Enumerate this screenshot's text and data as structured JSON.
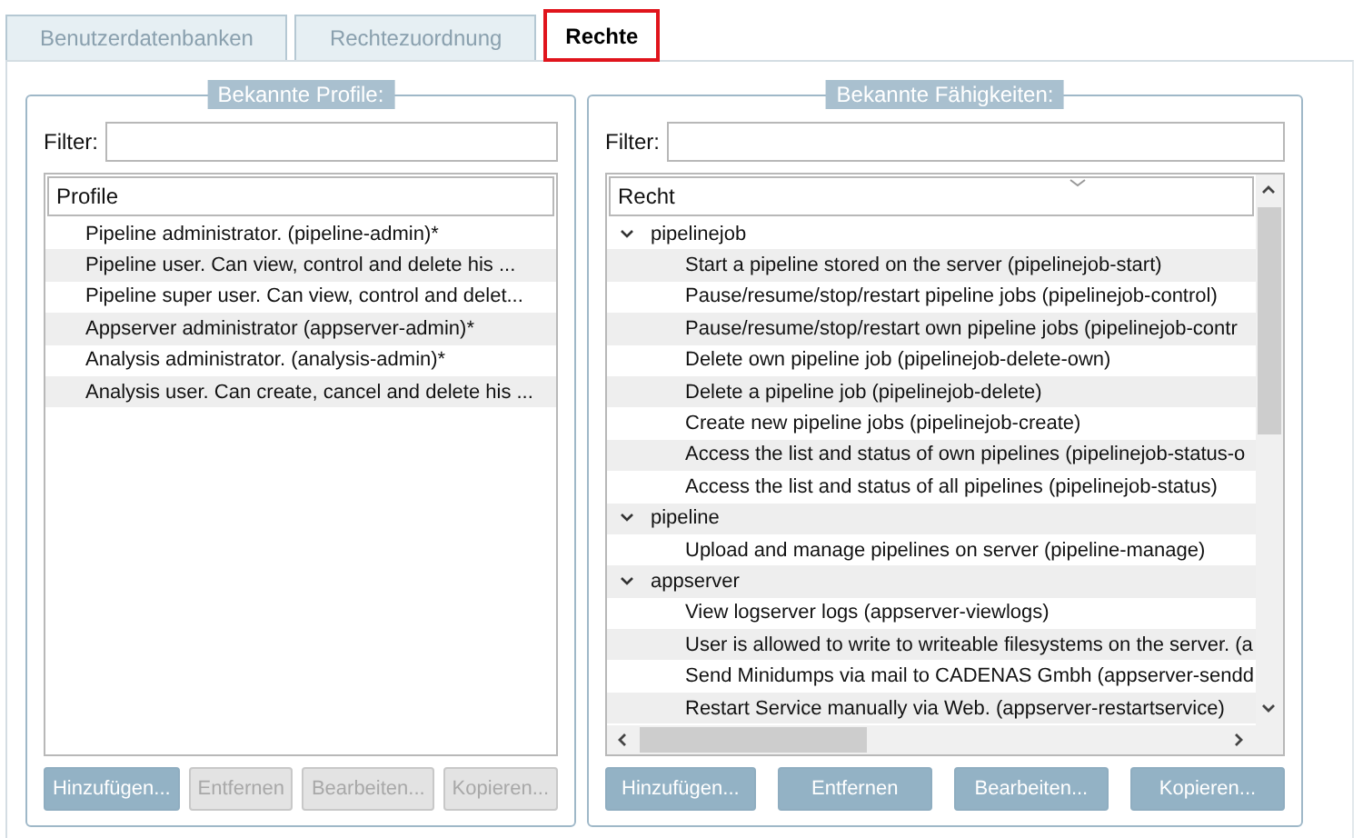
{
  "tabs": [
    {
      "label": "Benutzerdatenbanken",
      "selected": false
    },
    {
      "label": "Rechtezuordnung",
      "selected": false
    },
    {
      "label": "Rechte",
      "selected": true
    }
  ],
  "profiles_panel": {
    "title": "Bekannte Profile:",
    "filter_label": "Filter:",
    "column": "Profile",
    "rows": [
      "Pipeline administrator. (pipeline-admin)*",
      "Pipeline user. Can view, control and delete his ...",
      "Pipeline super user. Can view, control and delet...",
      "Appserver administrator (appserver-admin)*",
      "Analysis administrator. (analysis-admin)*",
      "Analysis user. Can create, cancel and delete his ..."
    ],
    "buttons": [
      {
        "label": "Hinzufügen...",
        "disabled": false
      },
      {
        "label": "Entfernen",
        "disabled": true
      },
      {
        "label": "Bearbeiten...",
        "disabled": true
      },
      {
        "label": "Kopieren...",
        "disabled": true
      }
    ]
  },
  "rights_panel": {
    "title": "Bekannte Fähigkeiten:",
    "filter_label": "Filter:",
    "column": "Recht",
    "groups": [
      {
        "label": "pipelinejob",
        "expanded": true,
        "children": [
          "Start a pipeline stored on the server (pipelinejob-start)",
          "Pause/resume/stop/restart pipeline jobs (pipelinejob-control)",
          "Pause/resume/stop/restart own pipeline jobs (pipelinejob-contr",
          "Delete own pipeline job (pipelinejob-delete-own)",
          "Delete a pipeline job (pipelinejob-delete)",
          "Create new pipeline jobs (pipelinejob-create)",
          "Access the list and status of own pipelines (pipelinejob-status-o",
          "Access the list and status of all pipelines (pipelinejob-status)"
        ]
      },
      {
        "label": "pipeline",
        "expanded": true,
        "children": [
          "Upload and manage pipelines on server (pipeline-manage)"
        ]
      },
      {
        "label": "appserver",
        "expanded": true,
        "children": [
          "View logserver logs (appserver-viewlogs)",
          "User is allowed to write to writeable filesystems on the server. (a",
          "Send Minidumps via mail to CADENAS Gmbh (appserver-sendd",
          "Restart Service manually via Web. (appserver-restartservice)"
        ]
      }
    ],
    "buttons": [
      {
        "label": "Hinzufügen...",
        "disabled": false
      },
      {
        "label": "Entfernen",
        "disabled": false
      },
      {
        "label": "Bearbeiten...",
        "disabled": false
      },
      {
        "label": "Kopieren...",
        "disabled": false
      }
    ]
  }
}
